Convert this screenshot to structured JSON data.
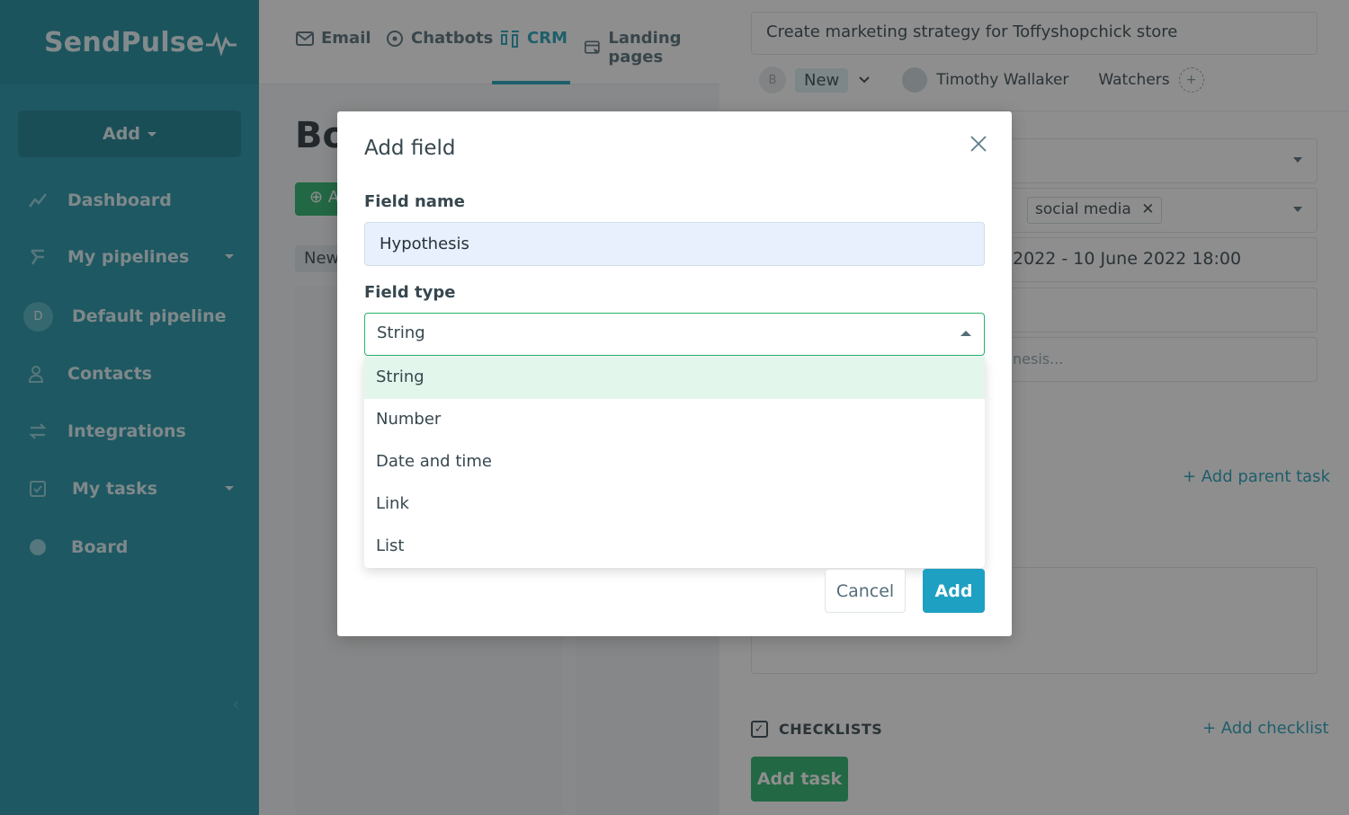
{
  "sidebar": {
    "logo": "SendPulse",
    "add_label": "Add",
    "items": [
      {
        "label": "Dashboard"
      },
      {
        "label": "My pipelines"
      },
      {
        "label": "Default pipeline",
        "avatar": "D"
      },
      {
        "label": "Contacts"
      },
      {
        "label": "Integrations"
      },
      {
        "label": "My tasks"
      },
      {
        "label": "Board"
      }
    ]
  },
  "topnav": {
    "items": [
      {
        "label": "Email"
      },
      {
        "label": "Chatbots"
      },
      {
        "label": "CRM"
      },
      {
        "label": "Landing pages"
      }
    ]
  },
  "board": {
    "title": "Bo",
    "add_btn": "⊕ A",
    "column_tag": "New"
  },
  "panel": {
    "task_title": "Create marketing strategy for Toffyshopchick store",
    "avatar_letter": "B",
    "status": "New",
    "assignee": "Timothy Wallaker",
    "watchers_label": "Watchers",
    "tag": "social media",
    "date_partial": "2022 - 10 June 2022 18:00",
    "hypothesis_partial": "nesis...",
    "add_parent_task": "+ Add parent task",
    "checklists_label": "CHECKLISTS",
    "add_checklist": "+ Add checklist",
    "add_task": "Add task"
  },
  "modal": {
    "title": "Add field",
    "field_name_label": "Field name",
    "field_name_value": "Hypothesis",
    "field_type_label": "Field type",
    "field_type_selected": "String",
    "options": [
      "String",
      "Number",
      "Date and time",
      "Link",
      "List"
    ],
    "cancel_label": "Cancel",
    "add_label": "Add"
  }
}
